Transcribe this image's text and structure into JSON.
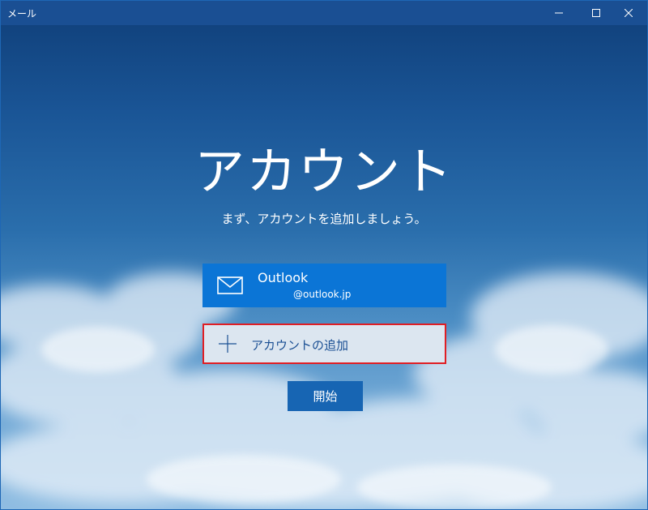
{
  "window": {
    "title": "メール"
  },
  "main": {
    "heading": "アカウント",
    "subheading": "まず、アカウントを追加しましょう。"
  },
  "account": {
    "name": "Outlook",
    "email": "@outlook.jp",
    "icon": "mail-icon"
  },
  "add_account": {
    "label": "アカウントの追加",
    "icon": "plus-icon"
  },
  "start_button": {
    "label": "開始"
  },
  "colors": {
    "titlebar": "#1a4f93",
    "account_tile": "#0b75d6",
    "add_tile_bg": "#dce6f0",
    "highlight_border": "#e01e24",
    "start_button": "#1765b3"
  }
}
